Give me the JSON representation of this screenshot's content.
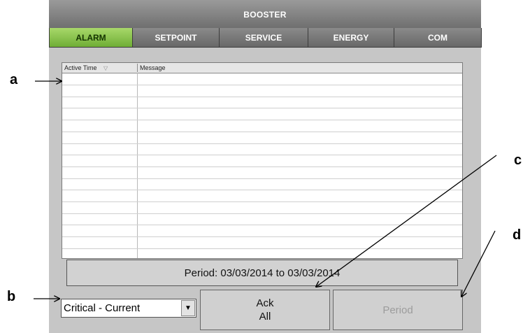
{
  "app": {
    "title": "BOOSTER"
  },
  "tabs": [
    {
      "label": "ALARM",
      "active": true
    },
    {
      "label": "SETPOINT",
      "active": false
    },
    {
      "label": "SERVICE",
      "active": false
    },
    {
      "label": "ENERGY",
      "active": false
    },
    {
      "label": "COM",
      "active": false
    }
  ],
  "alarm_table": {
    "columns": [
      "Active Time",
      "Message"
    ],
    "sort_indicator": "▽",
    "rows": []
  },
  "period_display": "Period: 03/03/2014 to 03/03/2014",
  "filter": {
    "selected": "Critical - Current",
    "arrow": "▼"
  },
  "buttons": {
    "ack_line1": "Ack",
    "ack_line2": "All",
    "period": "Period"
  },
  "annotations": {
    "a": "a",
    "b": "b",
    "c": "c",
    "d": "d"
  }
}
